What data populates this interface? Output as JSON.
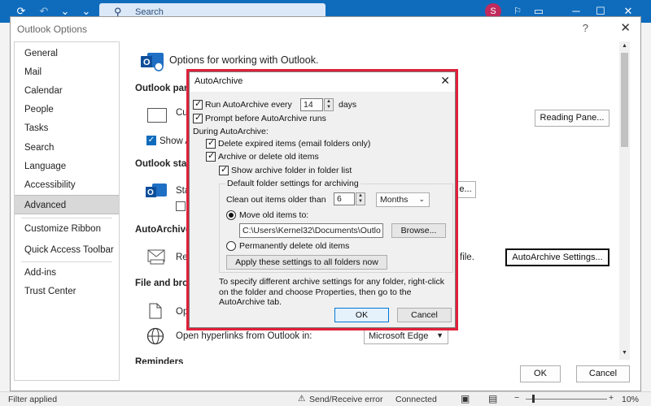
{
  "outlook_titlebar": {
    "search_placeholder": "Search",
    "avatar_initial": "S"
  },
  "options_window": {
    "title": "Outlook Options",
    "help": "?",
    "close": "✕",
    "nav_items": [
      "General",
      "Mail",
      "Calendar",
      "People",
      "Tasks",
      "Search",
      "Language",
      "Accessibility",
      "Advanced",
      "Customize Ribbon",
      "Quick Access Toolbar",
      "Add-ins",
      "Trust Center"
    ],
    "active_nav": "Advanced",
    "header": "Options for working with Outlook.",
    "sections": {
      "panes": "Outlook panes",
      "panes_row": "Cu",
      "panes_show": "Show A",
      "reading_pane_btn": "Reading Pane...",
      "start": "Outlook star",
      "start_row": "Sta",
      "start_btn": "e...",
      "autoarchive": "AutoArchive",
      "autoarchive_row": "Red",
      "autoarchive_tail": "file.",
      "autoarchive_btn": "AutoArchive Settings...",
      "file_browse": "File and brow",
      "open_row": "Op",
      "hyperlinks_label": "Open hyperlinks from Outlook in:",
      "hyperlinks_value": "Microsoft Edge",
      "next_section": "Reminders"
    },
    "ok": "OK",
    "cancel": "Cancel"
  },
  "status_bar": {
    "left": "Filter applied",
    "send_receive": "Send/Receive error",
    "connection": "Connected",
    "zoom": "10%"
  },
  "dialog": {
    "title": "AutoArchive",
    "close": "✕",
    "run_every_label": "Run AutoArchive every",
    "run_every_value": "14",
    "run_every_unit": "days",
    "prompt_label": "Prompt before AutoArchive runs",
    "during_label": "During AutoArchive:",
    "delete_expired_label": "Delete expired items (email folders only)",
    "archive_old_label": "Archive or delete old items",
    "show_archive_label": "Show archive folder in folder list",
    "group_label": "Default folder settings for archiving",
    "clean_out_label": "Clean out items older than",
    "clean_out_value": "6",
    "clean_out_unit": "Months",
    "move_label": "Move old items to:",
    "move_path": "C:\\Users\\Kernel32\\Documents\\Outlo",
    "browse_btn": "Browse...",
    "perm_delete_label": "Permanently delete old items",
    "apply_all_btn": "Apply these settings to all folders now",
    "info_text": "To specify different archive settings for any folder, right-click on the folder and choose Properties, then go to the AutoArchive tab.",
    "ok_btn": "OK",
    "cancel_btn": "Cancel",
    "accent_color": "#e0203a"
  }
}
